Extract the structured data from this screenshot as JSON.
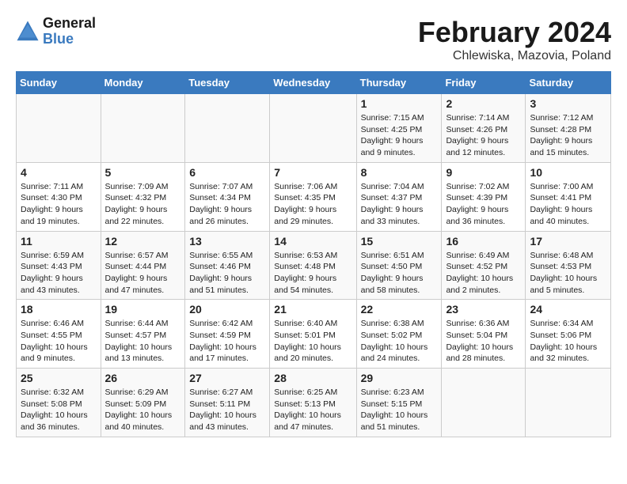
{
  "logo": {
    "text_general": "General",
    "text_blue": "Blue"
  },
  "title": "February 2024",
  "location": "Chlewiska, Mazovia, Poland",
  "days_of_week": [
    "Sunday",
    "Monday",
    "Tuesday",
    "Wednesday",
    "Thursday",
    "Friday",
    "Saturday"
  ],
  "weeks": [
    [
      {
        "day": "",
        "info": ""
      },
      {
        "day": "",
        "info": ""
      },
      {
        "day": "",
        "info": ""
      },
      {
        "day": "",
        "info": ""
      },
      {
        "day": "1",
        "info": "Sunrise: 7:15 AM\nSunset: 4:25 PM\nDaylight: 9 hours\nand 9 minutes."
      },
      {
        "day": "2",
        "info": "Sunrise: 7:14 AM\nSunset: 4:26 PM\nDaylight: 9 hours\nand 12 minutes."
      },
      {
        "day": "3",
        "info": "Sunrise: 7:12 AM\nSunset: 4:28 PM\nDaylight: 9 hours\nand 15 minutes."
      }
    ],
    [
      {
        "day": "4",
        "info": "Sunrise: 7:11 AM\nSunset: 4:30 PM\nDaylight: 9 hours\nand 19 minutes."
      },
      {
        "day": "5",
        "info": "Sunrise: 7:09 AM\nSunset: 4:32 PM\nDaylight: 9 hours\nand 22 minutes."
      },
      {
        "day": "6",
        "info": "Sunrise: 7:07 AM\nSunset: 4:34 PM\nDaylight: 9 hours\nand 26 minutes."
      },
      {
        "day": "7",
        "info": "Sunrise: 7:06 AM\nSunset: 4:35 PM\nDaylight: 9 hours\nand 29 minutes."
      },
      {
        "day": "8",
        "info": "Sunrise: 7:04 AM\nSunset: 4:37 PM\nDaylight: 9 hours\nand 33 minutes."
      },
      {
        "day": "9",
        "info": "Sunrise: 7:02 AM\nSunset: 4:39 PM\nDaylight: 9 hours\nand 36 minutes."
      },
      {
        "day": "10",
        "info": "Sunrise: 7:00 AM\nSunset: 4:41 PM\nDaylight: 9 hours\nand 40 minutes."
      }
    ],
    [
      {
        "day": "11",
        "info": "Sunrise: 6:59 AM\nSunset: 4:43 PM\nDaylight: 9 hours\nand 43 minutes."
      },
      {
        "day": "12",
        "info": "Sunrise: 6:57 AM\nSunset: 4:44 PM\nDaylight: 9 hours\nand 47 minutes."
      },
      {
        "day": "13",
        "info": "Sunrise: 6:55 AM\nSunset: 4:46 PM\nDaylight: 9 hours\nand 51 minutes."
      },
      {
        "day": "14",
        "info": "Sunrise: 6:53 AM\nSunset: 4:48 PM\nDaylight: 9 hours\nand 54 minutes."
      },
      {
        "day": "15",
        "info": "Sunrise: 6:51 AM\nSunset: 4:50 PM\nDaylight: 9 hours\nand 58 minutes."
      },
      {
        "day": "16",
        "info": "Sunrise: 6:49 AM\nSunset: 4:52 PM\nDaylight: 10 hours\nand 2 minutes."
      },
      {
        "day": "17",
        "info": "Sunrise: 6:48 AM\nSunset: 4:53 PM\nDaylight: 10 hours\nand 5 minutes."
      }
    ],
    [
      {
        "day": "18",
        "info": "Sunrise: 6:46 AM\nSunset: 4:55 PM\nDaylight: 10 hours\nand 9 minutes."
      },
      {
        "day": "19",
        "info": "Sunrise: 6:44 AM\nSunset: 4:57 PM\nDaylight: 10 hours\nand 13 minutes."
      },
      {
        "day": "20",
        "info": "Sunrise: 6:42 AM\nSunset: 4:59 PM\nDaylight: 10 hours\nand 17 minutes."
      },
      {
        "day": "21",
        "info": "Sunrise: 6:40 AM\nSunset: 5:01 PM\nDaylight: 10 hours\nand 20 minutes."
      },
      {
        "day": "22",
        "info": "Sunrise: 6:38 AM\nSunset: 5:02 PM\nDaylight: 10 hours\nand 24 minutes."
      },
      {
        "day": "23",
        "info": "Sunrise: 6:36 AM\nSunset: 5:04 PM\nDaylight: 10 hours\nand 28 minutes."
      },
      {
        "day": "24",
        "info": "Sunrise: 6:34 AM\nSunset: 5:06 PM\nDaylight: 10 hours\nand 32 minutes."
      }
    ],
    [
      {
        "day": "25",
        "info": "Sunrise: 6:32 AM\nSunset: 5:08 PM\nDaylight: 10 hours\nand 36 minutes."
      },
      {
        "day": "26",
        "info": "Sunrise: 6:29 AM\nSunset: 5:09 PM\nDaylight: 10 hours\nand 40 minutes."
      },
      {
        "day": "27",
        "info": "Sunrise: 6:27 AM\nSunset: 5:11 PM\nDaylight: 10 hours\nand 43 minutes."
      },
      {
        "day": "28",
        "info": "Sunrise: 6:25 AM\nSunset: 5:13 PM\nDaylight: 10 hours\nand 47 minutes."
      },
      {
        "day": "29",
        "info": "Sunrise: 6:23 AM\nSunset: 5:15 PM\nDaylight: 10 hours\nand 51 minutes."
      },
      {
        "day": "",
        "info": ""
      },
      {
        "day": "",
        "info": ""
      }
    ]
  ]
}
